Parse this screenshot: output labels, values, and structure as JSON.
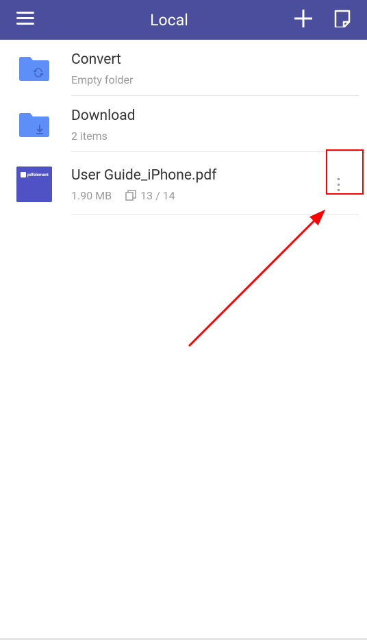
{
  "header": {
    "title": "Local"
  },
  "items": [
    {
      "type": "folder-sync",
      "name": "Convert",
      "subtitle": "Empty folder"
    },
    {
      "type": "folder-download",
      "name": "Download",
      "subtitle": "2 items"
    },
    {
      "type": "pdf",
      "name": "User Guide_iPhone.pdf",
      "size": "1.90 MB",
      "pages": "13 / 14",
      "thumb_label": "pdfelement"
    }
  ],
  "colors": {
    "header_bg": "#4a4e9c",
    "folder_blue": "#5e8ef7",
    "pdf_thumb": "#4e52c5",
    "annotation": "#ff0000"
  }
}
